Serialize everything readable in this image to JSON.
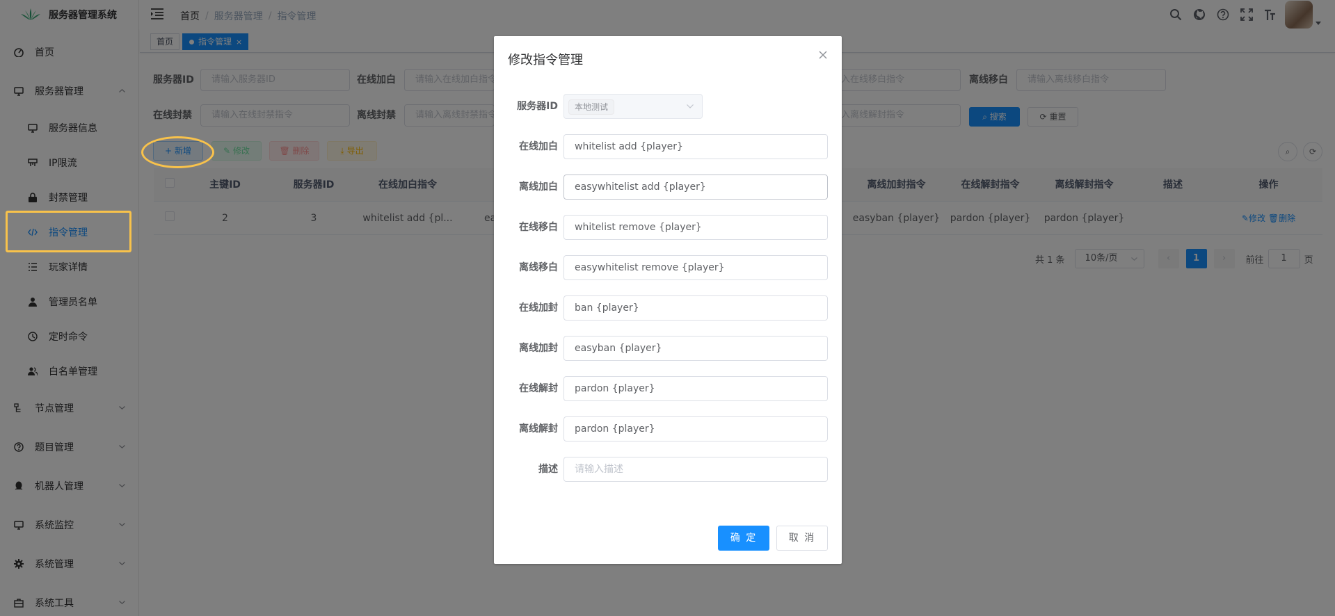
{
  "app": {
    "title": "服务器管理系统"
  },
  "sidebar": {
    "items": [
      {
        "label": "首页",
        "icon": "dashboard-icon"
      },
      {
        "label": "服务器管理",
        "icon": "monitor-icon"
      },
      {
        "label": "节点管理",
        "icon": "tree-icon"
      },
      {
        "label": "题目管理",
        "icon": "question-icon"
      },
      {
        "label": "机器人管理",
        "icon": "qq-icon"
      },
      {
        "label": "系统监控",
        "icon": "monitor-icon"
      },
      {
        "label": "系统管理",
        "icon": "gear-icon"
      },
      {
        "label": "系统工具",
        "icon": "toolbox-icon"
      }
    ],
    "server_sub": [
      {
        "label": "服务器信息",
        "icon": "monitor-icon"
      },
      {
        "label": "IP限流",
        "icon": "rate-limit-icon"
      },
      {
        "label": "封禁管理",
        "icon": "lock-icon"
      },
      {
        "label": "指令管理",
        "icon": "code-icon"
      },
      {
        "label": "玩家详情",
        "icon": "list-icon"
      },
      {
        "label": "管理员名单",
        "icon": "user-icon"
      },
      {
        "label": "定时命令",
        "icon": "clock-icon"
      },
      {
        "label": "白名单管理",
        "icon": "peoples-icon"
      }
    ]
  },
  "breadcrumb": [
    "首页",
    "服务器管理",
    "指令管理"
  ],
  "tags": [
    {
      "label": "首页"
    },
    {
      "label": "指令管理"
    }
  ],
  "search": {
    "fields": [
      {
        "label": "服务器ID",
        "placeholder": "请输入服务器ID"
      },
      {
        "label": "在线加白",
        "placeholder": "请输入在线加白指令"
      },
      {
        "label": "离线移白",
        "placeholder": "请输入离线移白指令"
      },
      {
        "label": "在线封禁",
        "placeholder": "请输入在线封禁指令"
      },
      {
        "label": "离线封禁",
        "placeholder": "请输入离线封禁指令"
      }
    ],
    "partial_placeholders": [
      "入在线移白指令",
      "入离线解封指令"
    ],
    "search_btn": "搜索",
    "reset_btn": "重置"
  },
  "toolbar": {
    "add": "新增",
    "edit": "修改",
    "delete": "删除",
    "export": "导出"
  },
  "table": {
    "headers": [
      "主键ID",
      "服务器ID",
      "在线加白指令",
      "离线加封指令",
      "在线解封指令",
      "离线解封指令",
      "描述",
      "操作"
    ],
    "rows": [
      {
        "id": "2",
        "server_id": "3",
        "online_whitelist": "whitelist add {pl...",
        "partial": "ea",
        "offline_ban": "easyban {player}",
        "online_unban": "pardon {player}",
        "offline_unban": "pardon {player}",
        "desc": "",
        "edit": "修改",
        "delete": "删除"
      }
    ]
  },
  "pagination": {
    "total": "共 1 条",
    "page_size": "10条/页",
    "current": "1",
    "goto_label": "前往",
    "goto_value": "1",
    "page_suffix": "页"
  },
  "dialog": {
    "title": "修改指令管理",
    "server_label": "服务器ID",
    "server_value": "本地测试",
    "fields": [
      {
        "label": "在线加白",
        "value": "whitelist add {player}"
      },
      {
        "label": "离线加白",
        "value": "easywhitelist add {player}"
      },
      {
        "label": "在线移白",
        "value": "whitelist remove {player}"
      },
      {
        "label": "离线移白",
        "value": "easywhitelist remove {player}"
      },
      {
        "label": "在线加封",
        "value": "ban {player}"
      },
      {
        "label": "离线加封",
        "value": "easyban {player}"
      },
      {
        "label": "在线解封",
        "value": "pardon {player}"
      },
      {
        "label": "离线解封",
        "value": "pardon {player}"
      }
    ],
    "desc_label": "描述",
    "desc_placeholder": "请输入描述",
    "confirm": "确 定",
    "cancel": "取 消"
  },
  "colors": {
    "primary": "#1890ff",
    "highlight": "#f8c24b",
    "success": "#13ce66",
    "danger": "#ff4949",
    "warning": "#ffba00"
  }
}
